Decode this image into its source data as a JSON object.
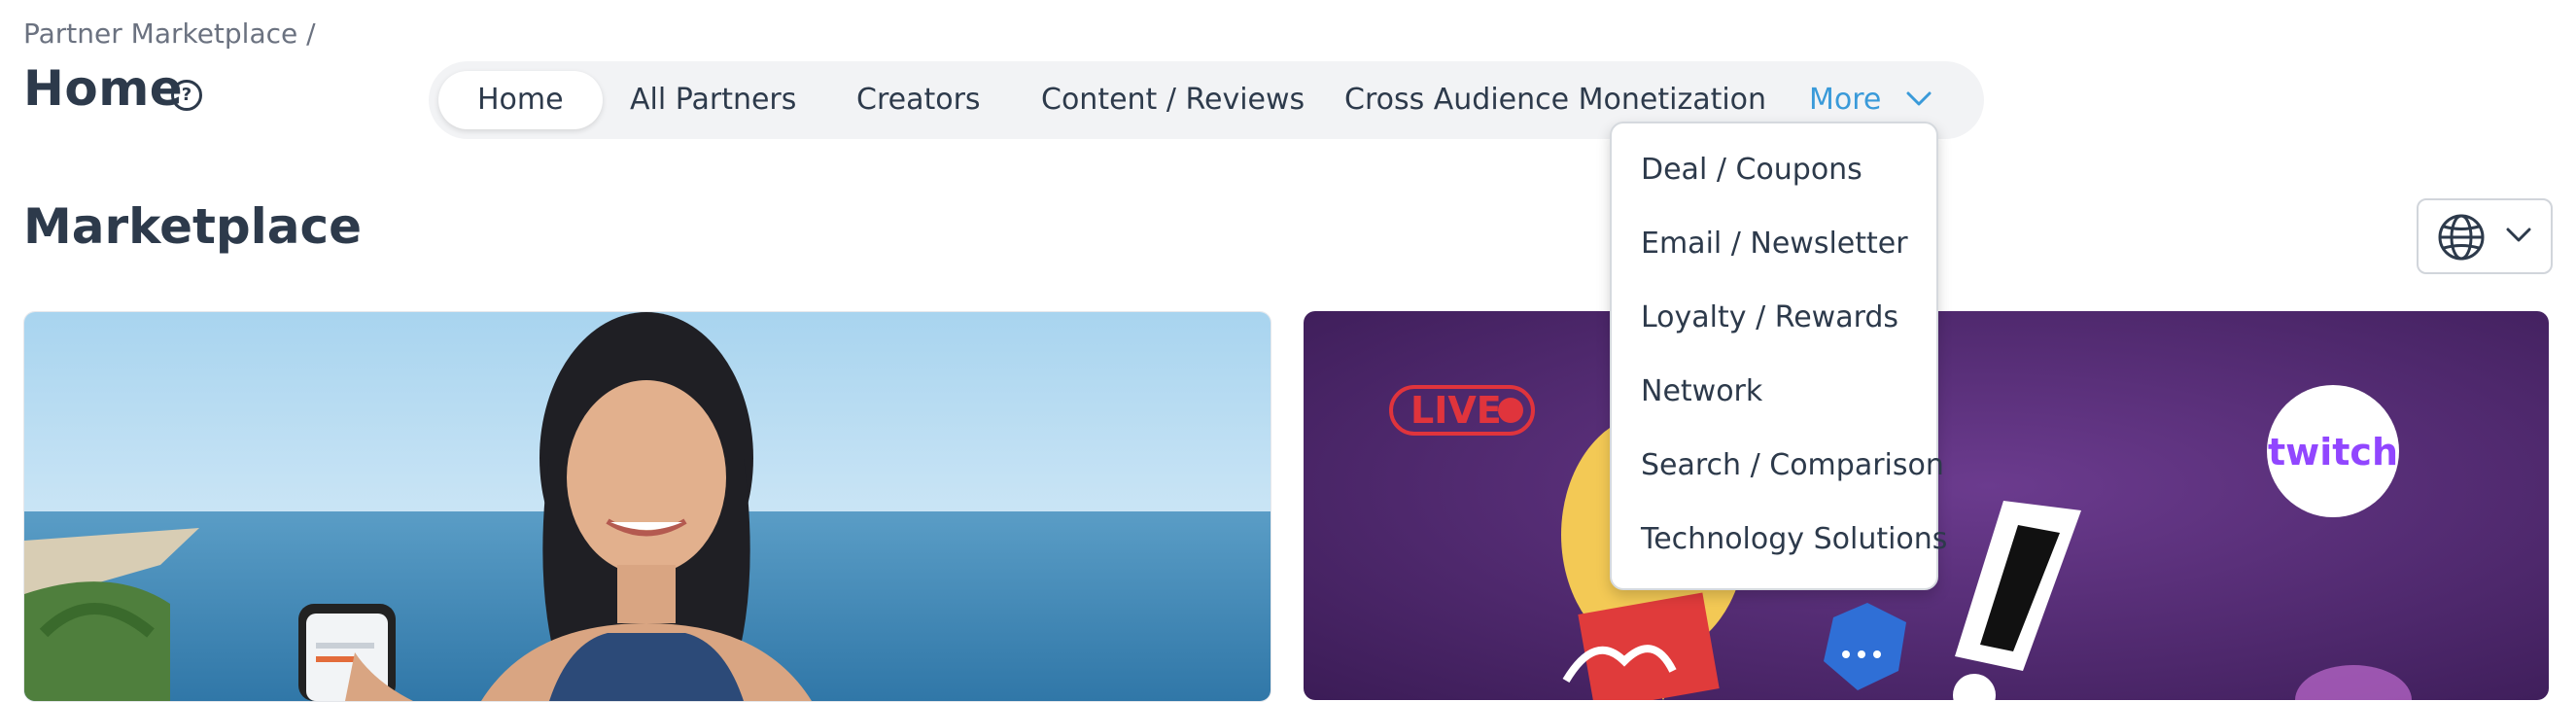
{
  "breadcrumb": "Partner Marketplace /",
  "page_title": "Home",
  "help_icon": "?",
  "tabs": {
    "home": "Home",
    "all_partners": "All Partners",
    "creators": "Creators",
    "content_reviews": "Content / Reviews",
    "cross_audience": "Cross Audience Monetization",
    "more": "More"
  },
  "more_menu": [
    "Deal / Coupons",
    "Email / Newsletter",
    "Loyalty / Rewards",
    "Network",
    "Search / Comparison",
    "Technology Solutions"
  ],
  "section_title": "Marketplace",
  "card2": {
    "live_label": "LIVE",
    "brand": "twitch"
  },
  "icons": {
    "help": "question-circle-icon",
    "more": "chevron-down-icon",
    "region": "globe-icon",
    "region_chevron": "chevron-down-icon"
  },
  "colors": {
    "text": "#2d3a4b",
    "accent": "#3a9ad9",
    "tabbar_bg": "#f2f3f5",
    "live_red": "#e0343c",
    "twitch_purple": "#9146ff"
  }
}
